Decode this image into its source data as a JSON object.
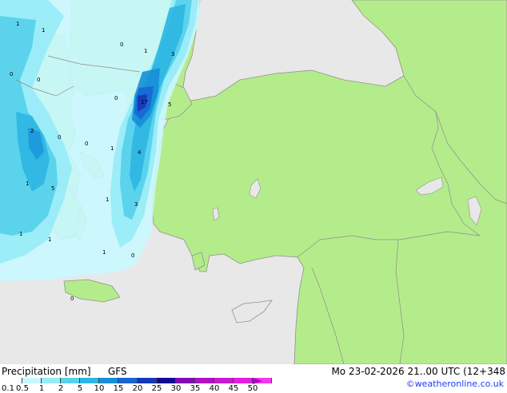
{
  "footer": {
    "title": "Precipitation [mm]",
    "model": "GFS",
    "datetime": "Mo 23-02-2026 21..00 UTC (12+348",
    "credit": "©weatheronline.co.uk"
  },
  "scale": {
    "labels": [
      "0.1",
      "0.5",
      "1",
      "2",
      "5",
      "10",
      "15",
      "20",
      "25",
      "30",
      "35",
      "40",
      "45",
      "50"
    ],
    "colors": [
      "#ffffff",
      "#c8f8ff",
      "#98ecf8",
      "#58d2ec",
      "#2cb6e2",
      "#168fd6",
      "#1866d4",
      "#1537b8",
      "#100c92",
      "#7f0cb4",
      "#ae12c4",
      "#cc18d2",
      "#e41ee0",
      "#f438ec"
    ]
  },
  "map_values": [
    "1",
    "1",
    "1",
    "0",
    "0",
    "0",
    "3",
    "0",
    "17",
    "5",
    "2",
    "0",
    "0",
    "1",
    "4",
    "1",
    "5",
    "1",
    "3",
    "1",
    "1",
    "1",
    "0",
    "0"
  ],
  "colors": {
    "land": "#b4ec8c",
    "sea": "#e8e8e8",
    "border": "#8c8c8c",
    "coast": "#909090"
  }
}
